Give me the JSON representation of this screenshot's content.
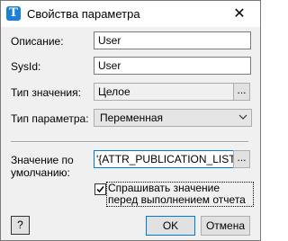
{
  "window": {
    "title": "Свойства параметра",
    "close_glyph": "✕",
    "icon_letter": "T"
  },
  "form": {
    "description_label": "Описание:",
    "description_value": "User",
    "sysid_label": "SysId:",
    "sysid_value": "User",
    "value_type_label": "Тип значения:",
    "value_type_value": "Целое",
    "value_type_button": "...",
    "param_type_label": "Тип параметра:",
    "param_type_value": "Переменная",
    "default_label_line1": "Значение по",
    "default_label_line2": "умолчанию:",
    "default_value": "'{ATTR_PUBLICATION_LIST_T'}",
    "default_button": "...",
    "ask_checkbox_checked": true,
    "ask_checkbox_label": "Спрашивать значение перед выполнением отчета"
  },
  "buttons": {
    "help": "?",
    "ok": "OK",
    "cancel": "Отмена"
  },
  "colors": {
    "focus_border": "#0078d7",
    "app_icon": "#1e7fd6"
  }
}
